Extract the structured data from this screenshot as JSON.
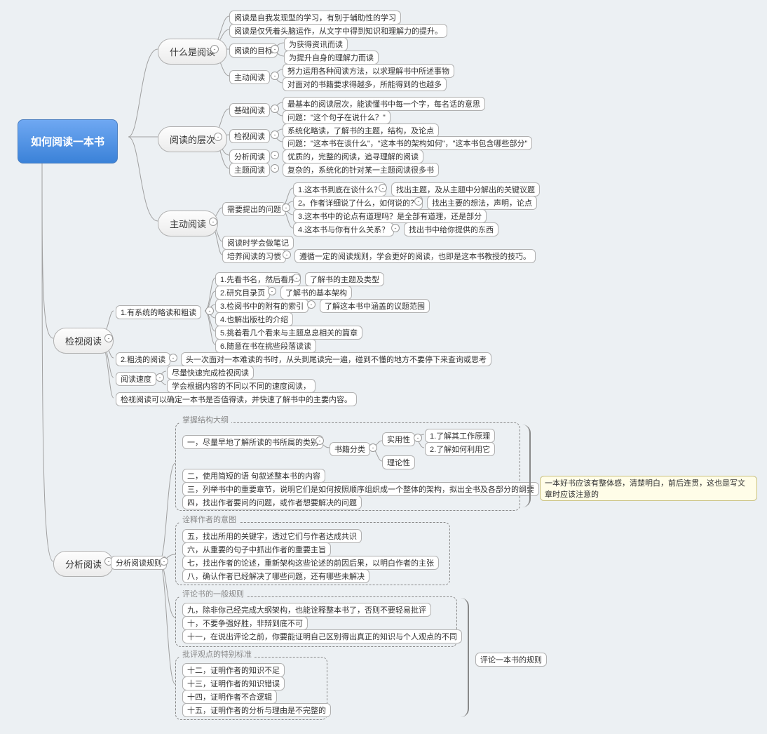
{
  "root": "如何阅读一本书",
  "m1": {
    "title": "什么是阅读",
    "c1": "阅读是自我发现型的学习，有别于辅助性的学习",
    "c2": "阅读是仅凭着头脑运作，从文字中得到知识和理解力的提升。",
    "c3": {
      "label": "阅读的目标",
      "a": "为获得资讯而读",
      "b": "为提升自身的理解力而读"
    },
    "c4": {
      "label": "主动阅读",
      "a": "努力运用各种阅读方法，以求理解书中所述事物",
      "b": "对面对的书籍要求得越多，所能得到的也越多"
    }
  },
  "m2": {
    "title": "阅读的层次",
    "c1": {
      "label": "基础阅读",
      "a": "最基本的阅读层次，能读懂书中每一个字，每名话的意思",
      "b": "问题：\"这个句子在说什么？\""
    },
    "c2": {
      "label": "检视阅读",
      "a": "系统化略读，了解书的主题，结构，及论点",
      "b": "问题：\"这本书在谈什么\"，\"这本书的架构如何\"，\"这本书包含哪些部分\""
    },
    "c3": {
      "label": "分析阅读",
      "a": "优质的，完整的阅读，追寻理解的阅读"
    },
    "c4": {
      "label": "主题阅读",
      "a": "复杂的，系统化的针对某一主题阅读很多书"
    }
  },
  "m3": {
    "title": "主动阅读",
    "q": {
      "label": "需要提出的问题",
      "q1": {
        "t": "1.这本书到底在谈什么？",
        "a": "找出主题，及从主题中分解出的关键议题"
      },
      "q2": {
        "t": "2。作者详细说了什么，如何说的？",
        "a": "找出主要的想法，声明，论点"
      },
      "q3": "3.这本书中的论点有道理吗？是全部有道理，还是部分",
      "q4": {
        "t": "4.这本书与你有什么关系？",
        "a": "找出书中给你提供的东西"
      }
    },
    "n1": "阅读时学会做笔记",
    "n2": {
      "t": "培养阅读的习惯",
      "a": "遵循一定的阅读规则，学会更好的阅读，也即是这本书教授的技巧。"
    }
  },
  "m4": {
    "title": "检视阅读",
    "s1": {
      "label": "1.有系统的略读和粗读",
      "i1": {
        "t": "1.先看书名，然后看序",
        "a": "了解书的主题及类型"
      },
      "i2": {
        "t": "2.研究目录页",
        "a": "了解书的基本架构"
      },
      "i3": {
        "t": "3.检阅书中的附有的索引",
        "a": "了解这本书中涵盖的议题范围"
      },
      "i4": "4.也解出版社的介绍",
      "i5": "5.挑着看几个看来与主题息息相关的篇章",
      "i6": "6.随意在书在挑些段落读读"
    },
    "s2": {
      "t": "2.粗浅的阅读",
      "a": "头一次面对一本难读的书时，从头到尾读完一遍，碰到不懂的地方不要停下来查询或思考"
    },
    "s3": {
      "label": "阅读速度",
      "a": "尽量快速完成检视阅读",
      "b": "学会根据内容的不同以不同的速度阅读，"
    },
    "s4": "检视阅读可以确定一本书是否值得读，并快速了解书中的主要内容。"
  },
  "m5": {
    "title": "分析阅读",
    "rule_label": "分析阅读规则",
    "g1": {
      "title": "掌握结构大纲",
      "r1": {
        "t": "一，尽量早地了解所读的书所属的类别",
        "cat": {
          "label": "书籍分类",
          "a": {
            "t": "实用性",
            "x": "1.了解其工作原理",
            "y": "2.了解如何利用它"
          },
          "b": "理论性"
        }
      },
      "r2": "二，使用简短的语 句叙述整本书的内容",
      "r3": "三，列举书中的重要章节，说明它们是如何按照顺序组织成一个整体的架构，拟出全书及各部分的纲要",
      "r4": "四，找出作者要问的问题，或作者想要解决的问题"
    },
    "g2": {
      "title": "诠释作者的意图",
      "r5": "五，找出所用的关键字，透过它们与作者达成共识",
      "r6": "六，从重要的句子中抓出作者的重要主旨",
      "r7": "七，找出作者的论述，重新架构这些论述的前因后果，以明白作者的主张",
      "r8": "八，确认作者已经解决了哪些问题，还有哪些未解决"
    },
    "g3": {
      "title": "评论书的一般规则",
      "r9": "九，除非你己经完成大纲架构，也能诠释整本书了，否则不要轻易批评",
      "r10": "十，不要争强好胜，非辩到底不可",
      "r11": "十一，在说出评论之前，你要能证明自己区别得出真正的知识与个人观点的不同"
    },
    "g4": {
      "title": "批评观点的特别标准",
      "r12": "十二，证明作者的知识不足",
      "r13": "十三，证明作者的知识错误",
      "r14": "十四，证明作者不合逻辑",
      "r15": "十五，证明作者的分析与理由是不完整的"
    },
    "callout1": "一本好书应该有整体感，清楚明白，前后连贯，这也是写文章时应该注意的",
    "callout2": "评论一本书的规则"
  }
}
